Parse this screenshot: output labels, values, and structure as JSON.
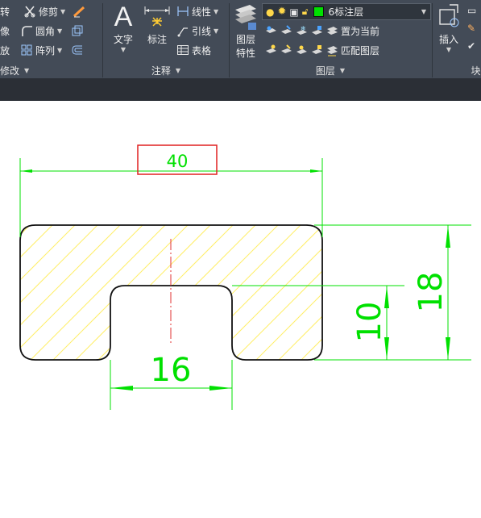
{
  "ribbon": {
    "modify": {
      "items": [
        "转",
        "像",
        "放"
      ],
      "trim_label": "修剪",
      "fillet_label": "圆角",
      "array_label": "阵列",
      "panel_label": "修改"
    },
    "annotation": {
      "text_label": "文字",
      "dimension_label": "标注",
      "linear_label": "线性",
      "leader_label": "引线",
      "table_label": "表格",
      "panel_label": "注释"
    },
    "layers": {
      "properties_label_1": "图层",
      "properties_label_2": "特性",
      "current_layer": "6标注层",
      "current_layer_color": "#00e000",
      "set_current_label": "置为当前",
      "match_label": "匹配图层",
      "panel_label": "图层"
    },
    "block": {
      "insert_label": "插入",
      "panel_label_partial": "块"
    }
  },
  "drawing": {
    "dims": {
      "width": "40",
      "slot_width": "16",
      "height": "18",
      "slot_depth": "10"
    },
    "colors": {
      "dimension": "#00e000",
      "hatch": "#ffee66",
      "outline": "#111111",
      "centerline": "#e03030",
      "highlight_box": "#e02020"
    }
  }
}
